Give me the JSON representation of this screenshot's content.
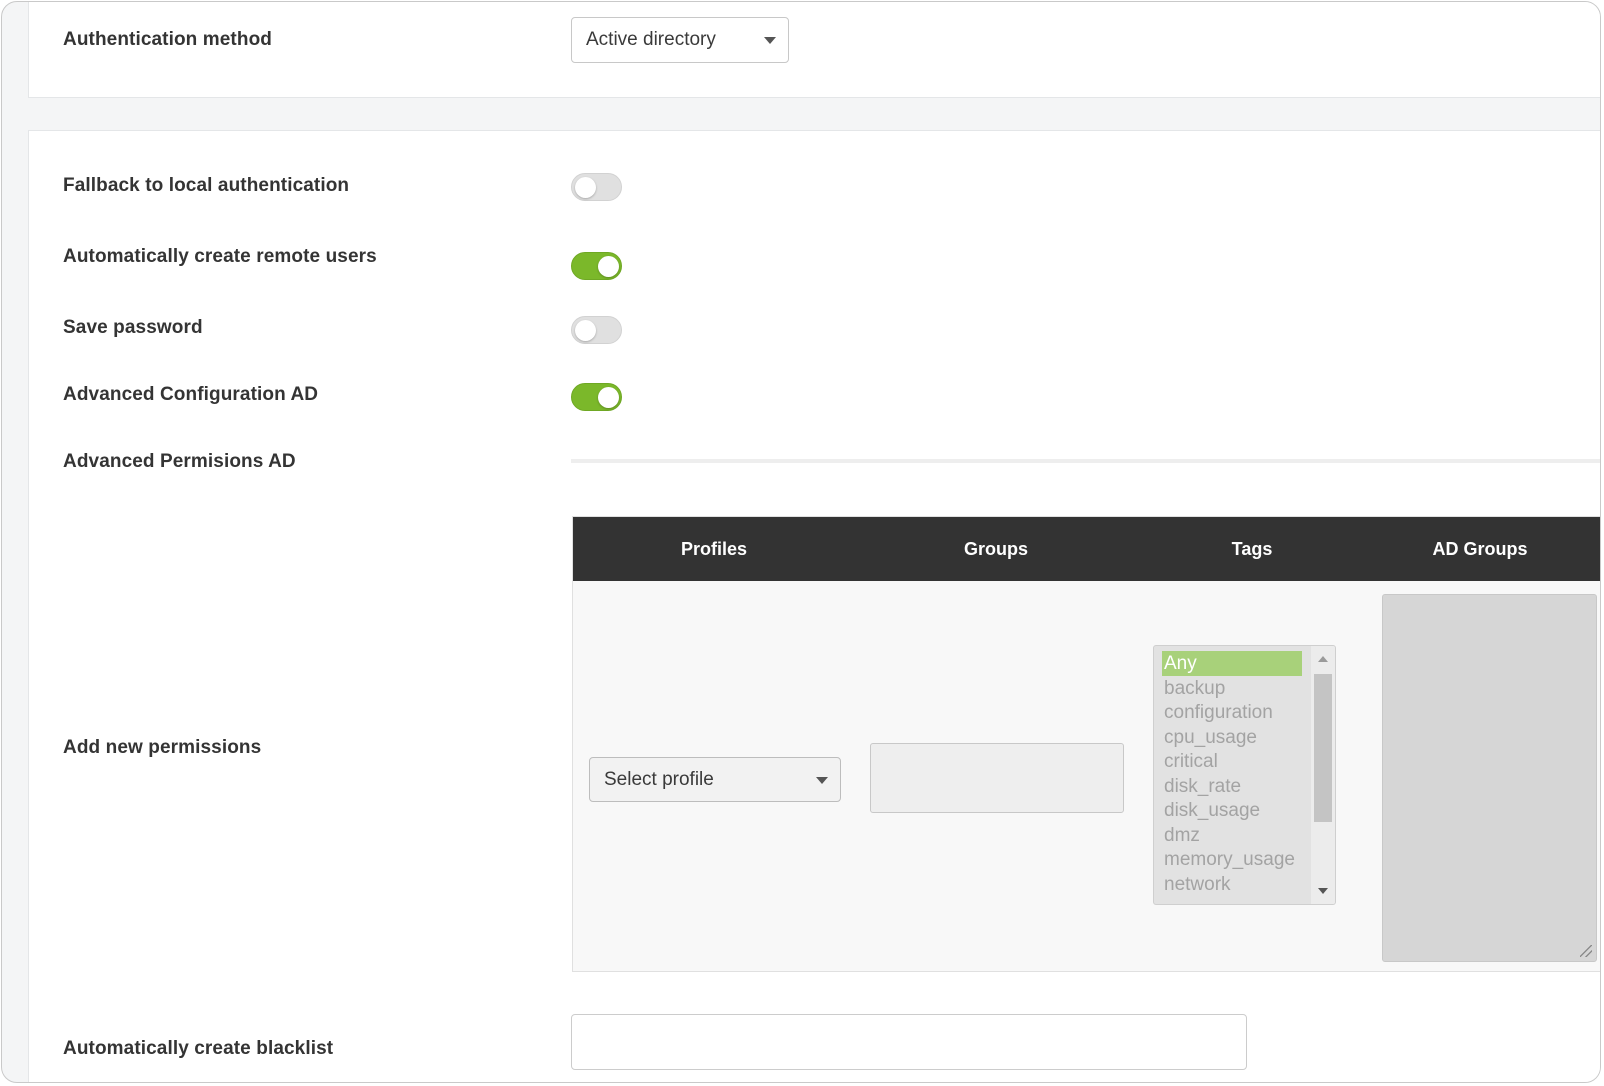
{
  "auth": {
    "method_label": "Authentication method",
    "method_value": "Active directory"
  },
  "settings": {
    "fallback_label": "Fallback to local authentication",
    "fallback_on": false,
    "auto_create_users_label": "Automatically create remote users",
    "auto_create_users_on": true,
    "save_password_label": "Save password",
    "save_password_on": false,
    "advanced_config_label": "Advanced Configuration AD",
    "advanced_config_on": true,
    "advanced_permissions_label": "Advanced Permisions AD"
  },
  "permissions": {
    "add_label": "Add new permissions",
    "columns": [
      "Profiles",
      "Groups",
      "Tags",
      "AD Groups"
    ],
    "profile_select_value": "Select profile",
    "groups_value": "",
    "tags_options": [
      "Any",
      "backup",
      "configuration",
      "cpu_usage",
      "critical",
      "disk_rate",
      "disk_usage",
      "dmz",
      "memory_usage",
      "network"
    ],
    "tags_selected": "Any"
  },
  "blacklist": {
    "label": "Automatically create blacklist",
    "value": ""
  },
  "colors": {
    "toggle_on": "#7bb82a",
    "table_header": "#333333",
    "selected_option": "#a8d17a"
  }
}
